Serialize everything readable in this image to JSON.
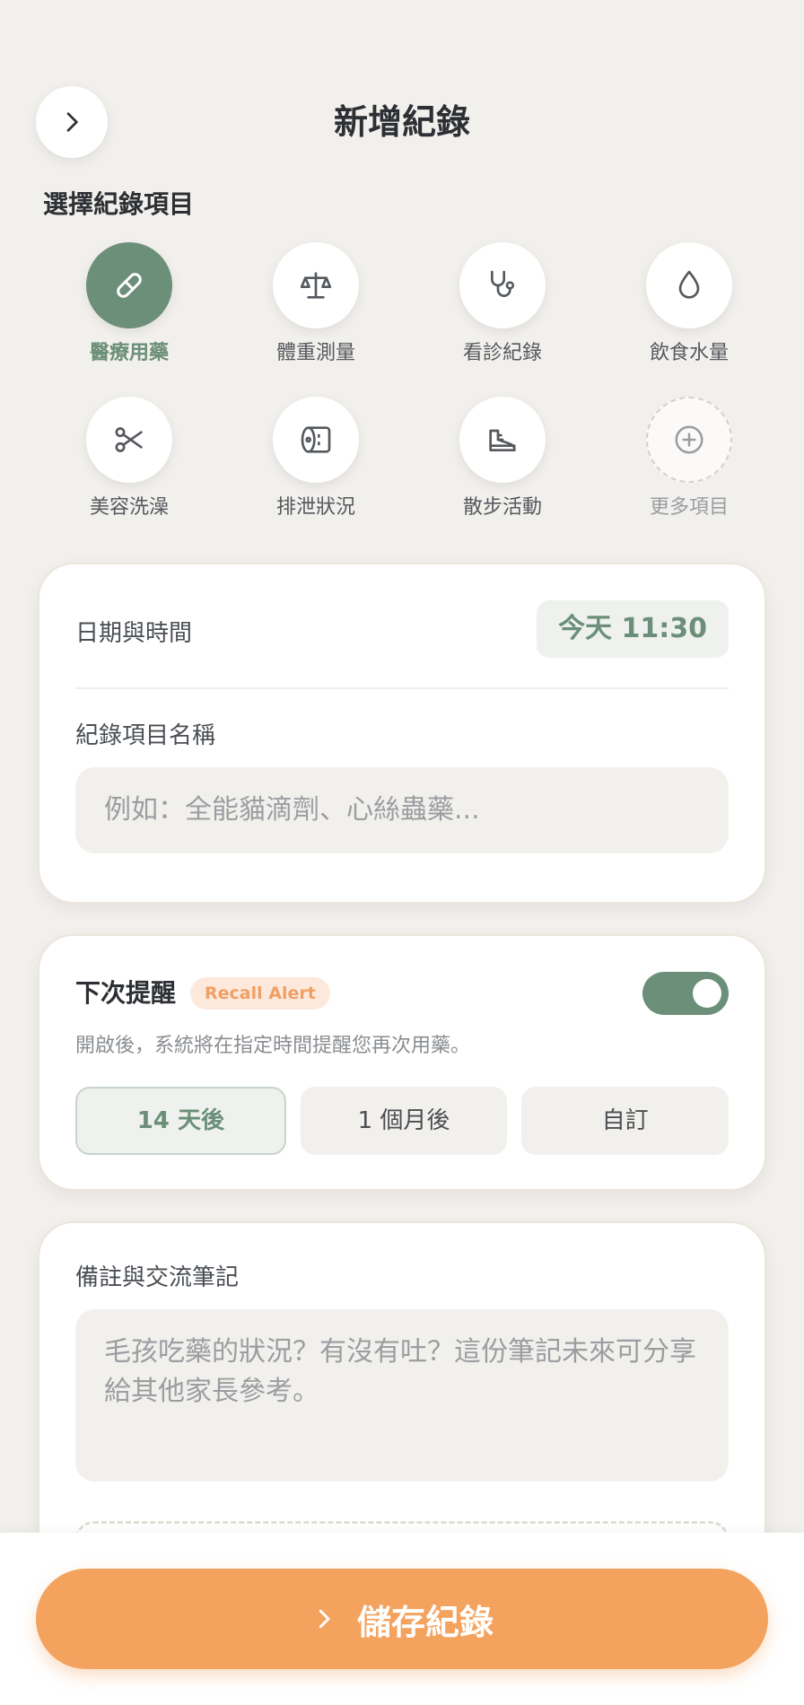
{
  "header": {
    "title": "新增紀錄"
  },
  "section": {
    "select_label": "選擇紀錄項目"
  },
  "categories": [
    {
      "label": "醫療用藥",
      "icon": "pill-icon",
      "active": true
    },
    {
      "label": "體重測量",
      "icon": "scale-icon"
    },
    {
      "label": "看診紀錄",
      "icon": "stethoscope-icon"
    },
    {
      "label": "飲食水量",
      "icon": "water-drop-icon"
    },
    {
      "label": "美容洗澡",
      "icon": "scissors-icon"
    },
    {
      "label": "排泄狀況",
      "icon": "toilet-paper-icon"
    },
    {
      "label": "散步活動",
      "icon": "sneaker-icon"
    },
    {
      "label": "更多項目",
      "icon": "plus-circle-icon"
    }
  ],
  "datetime": {
    "label": "日期與時間",
    "value": "今天 11:30"
  },
  "record_name": {
    "label": "紀錄項目名稱",
    "placeholder": "例如：全能貓滴劑、心絲蟲藥..."
  },
  "reminder": {
    "title": "下次提醒",
    "badge": "Recall Alert",
    "enabled": true,
    "description": "開啟後，系統將在指定時間提醒您再次用藥。",
    "options": [
      "14 天後",
      "1 個月後",
      "自訂"
    ],
    "selected_option": "14 天後"
  },
  "notes": {
    "label": "備註與交流筆記",
    "placeholder": "毛孩吃藥的狀況？有沒有吐？這份筆記未來可分享給其他家長參考。"
  },
  "footer": {
    "save_label": "儲存紀錄"
  },
  "colors": {
    "accent_green": "#6b8f78",
    "accent_orange": "#f4a35f",
    "background": "#f2f0ec"
  }
}
